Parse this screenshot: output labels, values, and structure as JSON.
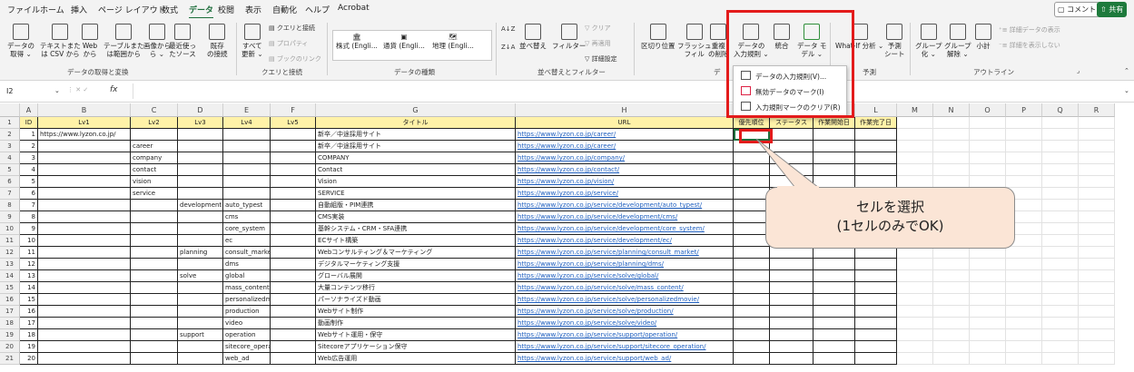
{
  "menu": [
    "ファイル",
    "ホーム",
    "挿入",
    "ページ レイアウト",
    "数式",
    "データ",
    "校閲",
    "表示",
    "自動化",
    "ヘルプ",
    "Acrobat"
  ],
  "active_menu": "データ",
  "top_right": {
    "comment": "コメント",
    "share": "共有"
  },
  "ribbon": {
    "get_data": {
      "b1": "データの",
      "b1b": "取得",
      "b2": "テキストまた",
      "b2b": "は CSV から",
      "b3": "Web",
      "b3b": "から",
      "b4": "テーブルまた",
      "b4b": "は範囲から",
      "b5": "画像から",
      "b5b": "ら",
      "b6": "最近使っ",
      "b6b": "たソース",
      "b7": "既存",
      "b7b": "の接続",
      "label": "データの取得と変換"
    },
    "queries": {
      "refresh": "すべて",
      "refresh_b": "更新",
      "s1": "クエリと接続",
      "s2": "プロパティ",
      "s3": "ブックのリンク",
      "label": "クエリと接続"
    },
    "types": {
      "t1": "株式 (Engli...",
      "t2": "通貨 (Engli...",
      "t3": "地理 (Engli...",
      "label": "データの種類"
    },
    "sort": {
      "az": "A↓Z",
      "za": "Z↓A",
      "sort": "並べ替え",
      "filter": "フィルター",
      "clear": "クリア",
      "reapply": "再適用",
      "advanced": "詳細設定",
      "label": "並べ替えとフィルター"
    },
    "tools": {
      "split": "区切り位置",
      "flash": "フラッシュ",
      "flash_b": "フィル",
      "dup": "重複",
      "dup_b": "の削除",
      "valid": "データの",
      "valid_b": "入力規則",
      "consolidate": "統合",
      "model": "データ モ",
      "model_b": "デル",
      "label": "デ"
    },
    "forecast": {
      "whatif": "What-If 分析",
      "sheet": "予測",
      "sheet_b": "シート",
      "label": "予測"
    },
    "outline": {
      "group": "グループ",
      "group_b": "化",
      "ungroup": "グループ",
      "ungroup_b": "解除",
      "subtotal": "小計",
      "show": "詳細データの表示",
      "hide": "詳細を表示しない",
      "label": "アウトライン"
    }
  },
  "dropdown": [
    "データの入力規則(V)...",
    "無効データのマーク(I)",
    "入力規則マークのクリア(R)"
  ],
  "name_box": "I2",
  "formula_fx": "fx",
  "columns": [
    "A",
    "B",
    "C",
    "D",
    "E",
    "F",
    "G",
    "H",
    "I",
    "J",
    "K",
    "L",
    "M",
    "N",
    "O",
    "P",
    "Q",
    "R"
  ],
  "headers": [
    "ID",
    "Lv1",
    "Lv2",
    "Lv3",
    "Lv4",
    "Lv5",
    "タイトル",
    "URL",
    "優先順位",
    "ステータス",
    "作業開始日",
    "作業完了日"
  ],
  "rows": [
    [
      "1",
      "https://www.lyzon.co.jp/",
      "",
      "",
      "",
      "",
      "新卒／中途採用サイト",
      "https://www.lyzon.co.jp/career/"
    ],
    [
      "2",
      "",
      "career",
      "",
      "",
      "",
      "新卒／中途採用サイト",
      "https://www.lyzon.co.jp/career/"
    ],
    [
      "3",
      "",
      "company",
      "",
      "",
      "",
      "COMPANY",
      "https://www.lyzon.co.jp/company/"
    ],
    [
      "4",
      "",
      "contact",
      "",
      "",
      "",
      "Contact",
      "https://www.lyzon.co.jp/contact/"
    ],
    [
      "5",
      "",
      "vision",
      "",
      "",
      "",
      "Vision",
      "https://www.lyzon.co.jp/vision/"
    ],
    [
      "6",
      "",
      "service",
      "",
      "",
      "",
      "SERVICE",
      "https://www.lyzon.co.jp/service/"
    ],
    [
      "7",
      "",
      "",
      "development",
      "auto_typest",
      "",
      "自動組版・PIM連携",
      "https://www.lyzon.co.jp/service/development/auto_typest/"
    ],
    [
      "8",
      "",
      "",
      "",
      "cms",
      "",
      "CMS実装",
      "https://www.lyzon.co.jp/service/development/cms/"
    ],
    [
      "9",
      "",
      "",
      "",
      "core_system",
      "",
      "基幹システム・CRM・SFA連携",
      "https://www.lyzon.co.jp/service/development/core_system/"
    ],
    [
      "10",
      "",
      "",
      "",
      "ec",
      "",
      "ECサイト構築",
      "https://www.lyzon.co.jp/service/development/ec/"
    ],
    [
      "11",
      "",
      "",
      "planning",
      "consult_market",
      "",
      "Webコンサルティング＆マーケティング",
      "https://www.lyzon.co.jp/service/planning/consult_market/"
    ],
    [
      "12",
      "",
      "",
      "",
      "dms",
      "",
      "デジタルマーケティング支援",
      "https://www.lyzon.co.jp/service/planning/dms/"
    ],
    [
      "13",
      "",
      "",
      "solve",
      "global",
      "",
      "グローバル展開",
      "https://www.lyzon.co.jp/service/solve/global/"
    ],
    [
      "14",
      "",
      "",
      "",
      "mass_content",
      "",
      "大量コンテンツ移行",
      "https://www.lyzon.co.jp/service/solve/mass_content/"
    ],
    [
      "15",
      "",
      "",
      "",
      "personalizedmovie",
      "",
      "パーソナライズド動画",
      "https://www.lyzon.co.jp/service/solve/personalizedmovie/"
    ],
    [
      "16",
      "",
      "",
      "",
      "production",
      "",
      "Webサイト制作",
      "https://www.lyzon.co.jp/service/solve/production/"
    ],
    [
      "17",
      "",
      "",
      "",
      "video",
      "",
      "動画制作",
      "https://www.lyzon.co.jp/service/solve/video/"
    ],
    [
      "18",
      "",
      "",
      "support",
      "operation",
      "",
      "Webサイト運用・保守",
      "https://www.lyzon.co.jp/service/support/operation/"
    ],
    [
      "19",
      "",
      "",
      "",
      "sitecore_operation",
      "",
      "Sitecoreアプリケーション保守",
      "https://www.lyzon.co.jp/service/support/sitecore_operation/"
    ],
    [
      "20",
      "",
      "",
      "",
      "web_ad",
      "",
      "Web広告運用",
      "https://www.lyzon.co.jp/service/support/web_ad/"
    ]
  ],
  "callout": {
    "line1": "セルを選択",
    "line2": "(1セルのみでOK)"
  },
  "colors": {
    "highlight": "#e31b1b",
    "header_fill": "#fff2a8",
    "callout_fill": "#fbe5d6",
    "excel_green": "#1e6e3c"
  }
}
